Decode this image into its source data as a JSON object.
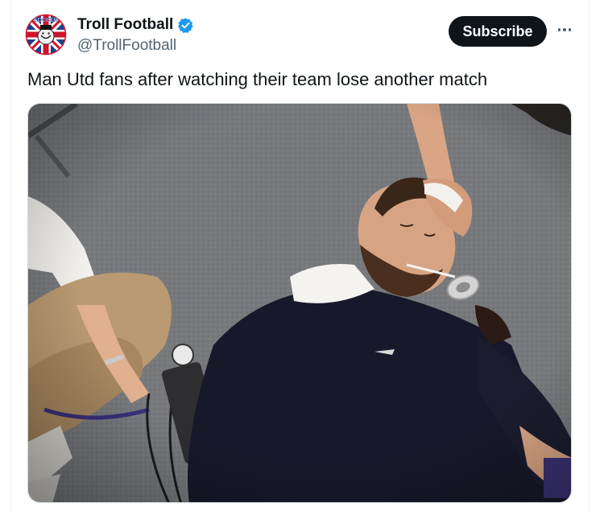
{
  "author": {
    "display_name": "Troll Football",
    "handle": "@TrollFootball",
    "avatar_text": "SOCCER",
    "verified_icon": "verified-badge-icon"
  },
  "actions": {
    "subscribe_label": "Subscribe",
    "more_icon": "more-options-icon"
  },
  "tweet": {
    "text": "Man Utd fans after watching their team lose another match"
  },
  "colors": {
    "text_primary": "#0f1419",
    "text_secondary": "#536471",
    "verified_blue": "#1d9bf0",
    "button_bg": "#0f1419",
    "button_text": "#ffffff",
    "border": "#cfd9de"
  }
}
